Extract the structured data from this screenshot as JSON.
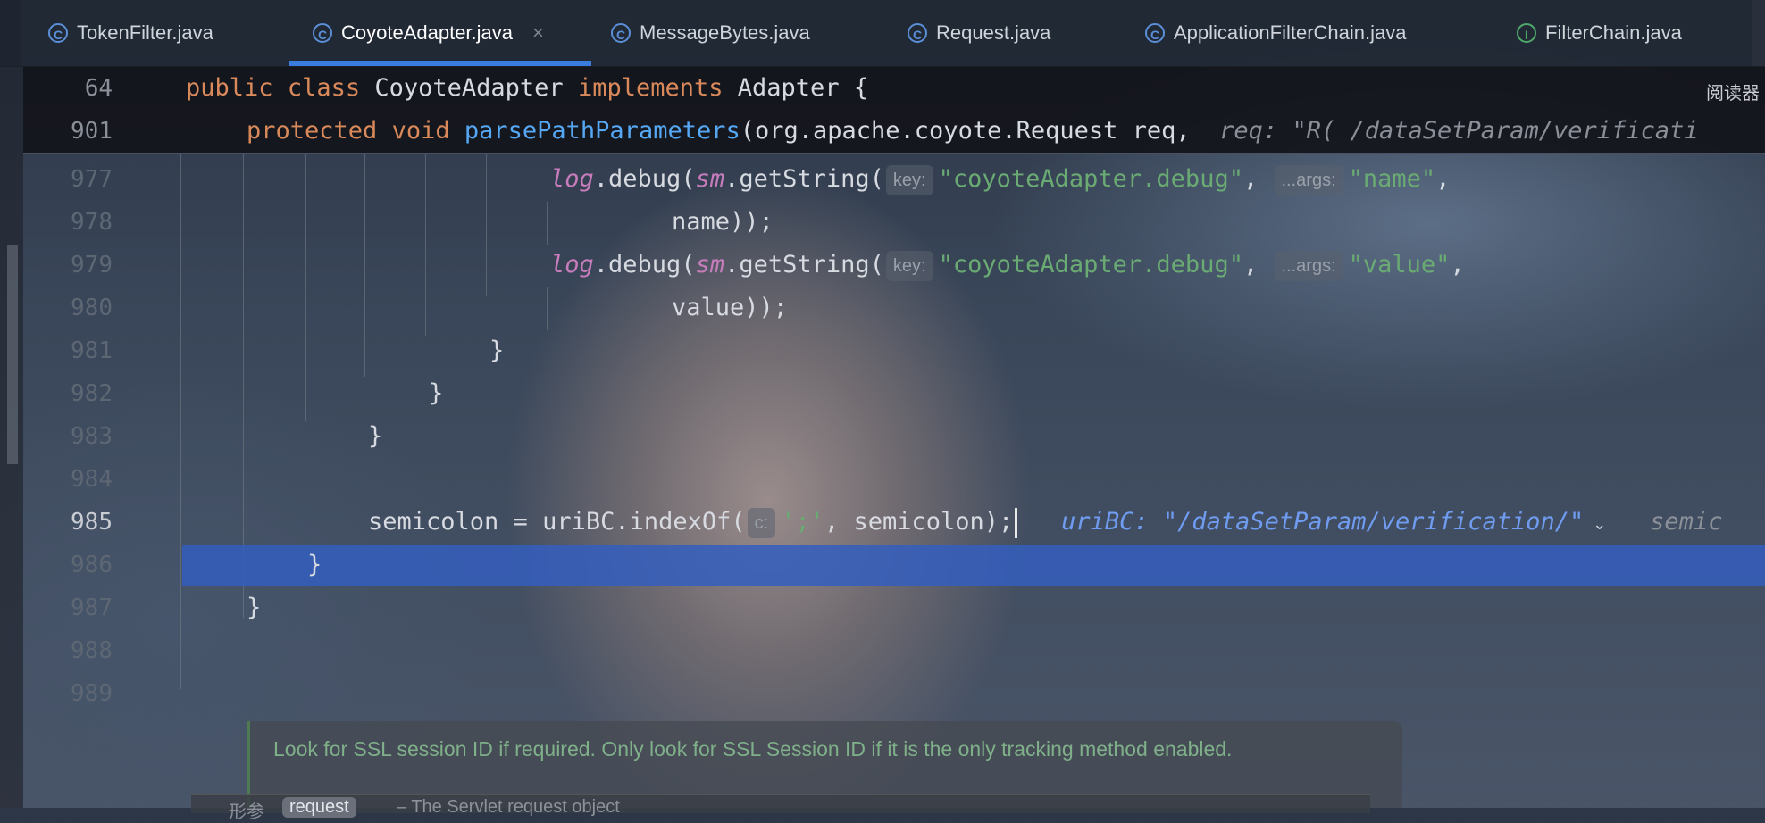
{
  "tabs": [
    {
      "label": "TokenFilter.java",
      "icon": "class-icon",
      "glyph": "C"
    },
    {
      "label": "CoyoteAdapter.java",
      "icon": "class-icon",
      "glyph": "C",
      "active": true
    },
    {
      "label": "MessageBytes.java",
      "icon": "class-icon",
      "glyph": "C"
    },
    {
      "label": "Request.java",
      "icon": "class-icon",
      "glyph": "C"
    },
    {
      "label": "ApplicationFilterChain.java",
      "icon": "class-icon",
      "glyph": "C"
    },
    {
      "label": "FilterChain.java",
      "icon": "interface-icon",
      "glyph": "I"
    }
  ],
  "tab_close_glyph": "×",
  "reader_mode": "阅读器",
  "sticky": {
    "line1": {
      "num": "64",
      "kw1": "public",
      "kw2": "class",
      "name": "CoyoteAdapter",
      "kw3": "implements",
      "rest": "Adapter {"
    },
    "line2": {
      "num": "901",
      "kw1": "protected",
      "kw2": "void",
      "fn": "parsePathParameters",
      "args": "(org.apache.coyote.Request req,",
      "inlay": "req: \"R( /dataSetParam/verificati"
    }
  },
  "code": {
    "l977": {
      "num": "977",
      "log": "log",
      "mid": ".debug(",
      "sm": "sm",
      "call": ".getString(",
      "hint_key": "key:",
      "str": "\"coyoteAdapter.debug\"",
      "comma": ",",
      "hint_args": "...args:",
      "str2": "\"name\"",
      "end": ","
    },
    "l978": {
      "num": "978",
      "text": "name));"
    },
    "l979": {
      "num": "979",
      "log": "log",
      "mid": ".debug(",
      "sm": "sm",
      "call": ".getString(",
      "hint_key": "key:",
      "str": "\"coyoteAdapter.debug\"",
      "comma": ",",
      "hint_args": "...args:",
      "str2": "\"value\"",
      "end": ","
    },
    "l980": {
      "num": "980",
      "text": "value));"
    },
    "l981": {
      "num": "981",
      "text": "}"
    },
    "l982": {
      "num": "982",
      "text": "}"
    },
    "l983": {
      "num": "983",
      "text": "}"
    },
    "l984": {
      "num": "984",
      "text": ""
    },
    "l985": {
      "num": "985",
      "pre": "semicolon = uriBC.indexOf(",
      "hint_c": "c:",
      "str": "';'",
      "post": ", semicolon);",
      "inlay": "uriBC: \"/dataSetParam/verification/\"",
      "inlay2": "semic"
    },
    "l986": {
      "num": "986",
      "text": "}"
    },
    "l987": {
      "num": "987",
      "text": "}"
    },
    "l988": {
      "num": "988",
      "text": ""
    },
    "l989": {
      "num": "989",
      "text": ""
    }
  },
  "doc": {
    "text": "Look for SSL session ID if required. Only look for SSL Session ID if it is the only tracking method enabled.",
    "param_label": "形参",
    "param_name": "request",
    "param_desc": "– The Servlet request object"
  }
}
